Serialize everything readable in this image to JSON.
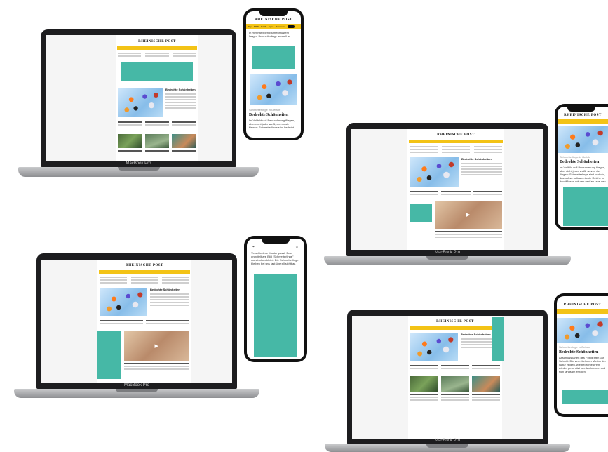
{
  "brand": "RHEINISCHE POST",
  "laptop_label": "MacBook Pro",
  "article": {
    "headline": "Bedrohte Schönheiten",
    "kicker": "Schmetterlinge in Gefahr",
    "body": "Im Vollbild voll Bewunderung fliegen, aber nicht jeder weiß, wovon sie fliegen: Schmetterlinge sind bedroht, das auf so seltsam rückte Reiche in den Wiesen mit den großen, aus den Flügeln nah mit bewundernden Mustern passt."
  },
  "phone_nav": [
    "Top",
    "NRW",
    "Politik",
    "Sport",
    "Panorama"
  ],
  "phone_top_text": "In mehrfarbigen Blumenmustern fangen Schmetterlinge schnell an",
  "phone_lower_text": "Abschlusskarten des Fotografen Jan Schmitt. Die vermittelnden Muster der Natur zeigen, wie bedrohte Arten wieder geschützt werden können und sich langsam erholen.",
  "phone_story_text": "Verschiedene Muster passt. Das unmittelbare Bild \"Schmetterlinge\" dazwischen bleibt. Die Schmetterlinge bleiben bei uns fast überall sichtbar."
}
